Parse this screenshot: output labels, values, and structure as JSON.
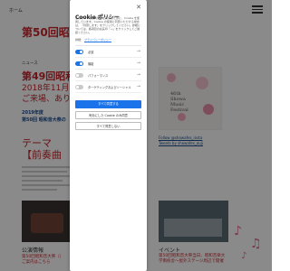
{
  "background": {
    "anchor_text": "ホーム",
    "title_50": "第50回昭和音",
    "news_label": "ニュース",
    "title_49": "第49回昭和音",
    "date_text": "2018年11月3日",
    "thanks_text": "ご来場、ありが",
    "year_text": "2019年度",
    "subtitle_text": "第50回 昭和音大祭の",
    "theme_label": "テーマ",
    "theme_value": "【前奏曲　―",
    "poster_text": [
      "46th",
      "Showa",
      "Music",
      "Festival"
    ],
    "follow_1": "Follow @showafes_insta",
    "follow_2": "Tweets by showafes_ouji",
    "caption_left": "公演情報",
    "link_left": "第50回昭和音大祭（）",
    "link_left_2": "ご案内はこちら",
    "caption_right": "イベント",
    "link_right": "第50回昭和音大祭当日、昭和音楽大学南校舎〜屋外ステージ周辺で開催"
  },
  "cookie_dialog": {
    "title": "Cookie ポリシー",
    "close_icon": "close-icon",
    "description": "このサイトでは利便性を高めるために、Cookie を使用しています。Cookie の使用に同意いただける場合は、「同意します」をクリックしてください。詳細については、各項目の右矢印「→」をクリックしてご確認ください。",
    "details_label": "詳細：",
    "details_link": "プライバシーポリシー",
    "categories": [
      {
        "label": "必須",
        "enabled": true
      },
      {
        "label": "機能",
        "enabled": true
      },
      {
        "label": "パフォーマンス",
        "enabled": false
      },
      {
        "label": "ターゲティングおよびソーシャル",
        "enabled": false
      }
    ],
    "btn_accept_all": "すべて同意する",
    "btn_accept_selected": "有効にした Cookie のみ同意",
    "btn_reject_all": "すべて同意しない"
  },
  "colors": {
    "brand_red": "#c8232c",
    "accent_blue": "#1a73e8",
    "link_blue": "#1a4c8c"
  }
}
